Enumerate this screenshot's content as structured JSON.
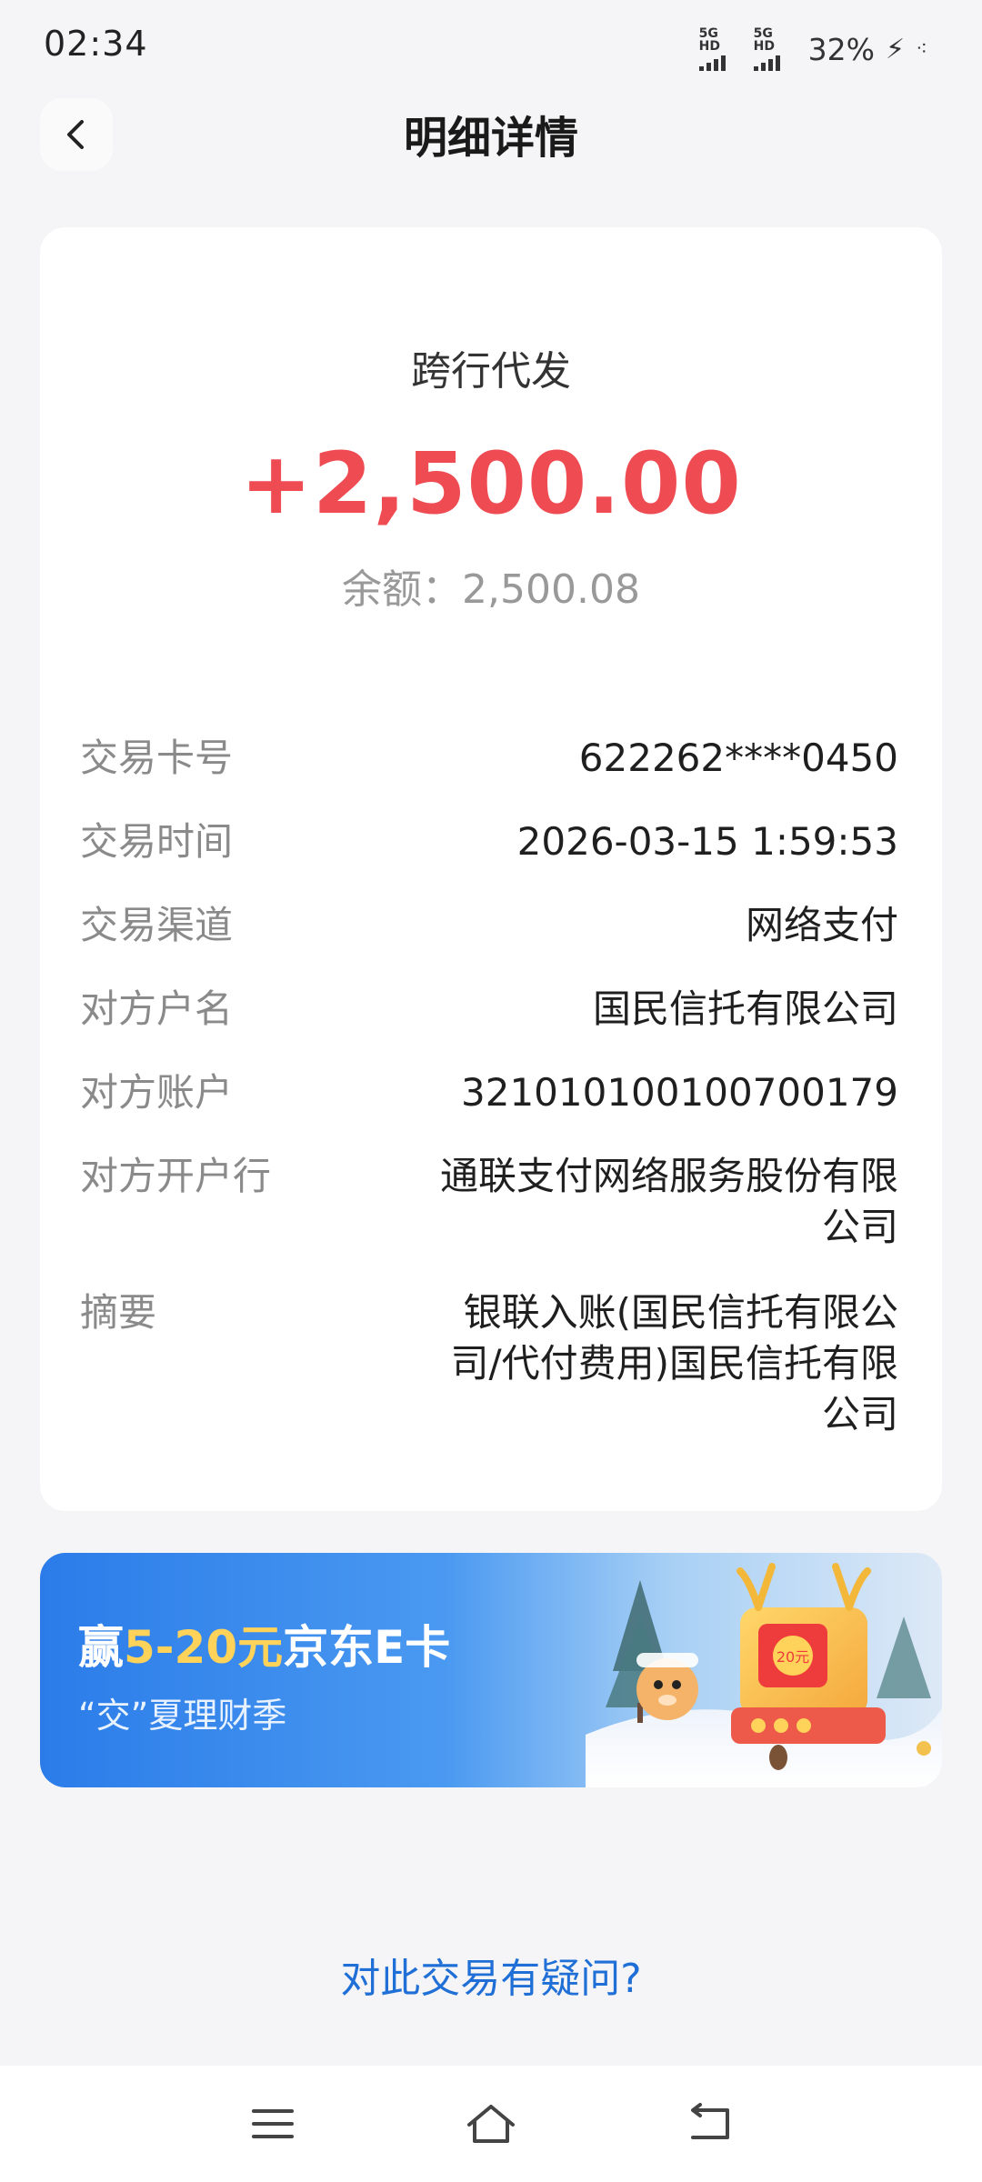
{
  "status_bar": {
    "time": "02:34",
    "network_1": "5G HD",
    "network_2": "5G HD",
    "battery": "32%"
  },
  "header": {
    "title": "明细详情",
    "back_icon": "chevron-left-icon"
  },
  "transaction": {
    "type": "跨行代发",
    "amount": "+2,500.00",
    "balance": "余额：2,500.08",
    "amount_color": "#ee4c52"
  },
  "details": [
    {
      "label": "交易卡号",
      "value": "622262****0450"
    },
    {
      "label": "交易时间",
      "value": "2026-03-15 1:59:53"
    },
    {
      "label": "交易渠道",
      "value": "网络支付"
    },
    {
      "label": "对方户名",
      "value": "国民信托有限公司"
    },
    {
      "label": "对方账户",
      "value": "321010100100700179"
    },
    {
      "label": "对方开户行",
      "value": "通联支付网络服务股份有限公司"
    },
    {
      "label": "摘要",
      "value": "银联入账(国民信托有限公司/代付费用)国民信托有限公司"
    }
  ],
  "promo": {
    "prefix": "赢",
    "highlight": "5-20元",
    "suffix": "京东E卡",
    "subtitle": "“交”夏理财季",
    "badge": "20元"
  },
  "footer": {
    "question": "对此交易有疑问?"
  },
  "nav": {
    "menu_icon": "menu-icon",
    "home_icon": "home-icon",
    "back_icon": "back-icon"
  }
}
